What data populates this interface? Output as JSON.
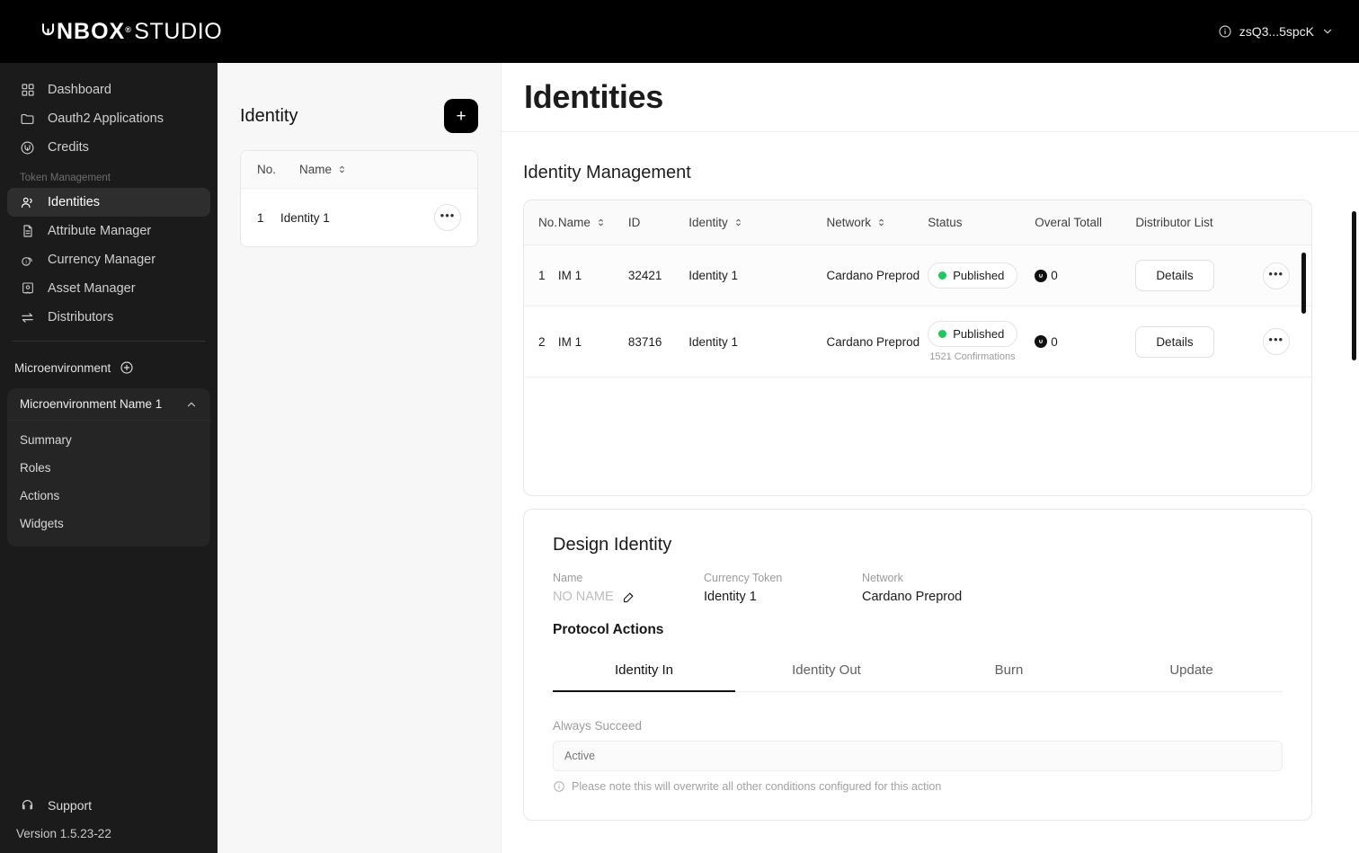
{
  "topbar": {
    "logo_mark": "U",
    "logo_bold": "NBOX",
    "logo_reg": "®",
    "logo_light": "STUDIO",
    "account_label": "zsQ3...5spcK",
    "info_icon": "info-circle-icon",
    "chevron_icon": "chevron-down-icon"
  },
  "sidebar": {
    "primary": [
      {
        "label": "Dashboard",
        "icon": "grid-icon"
      },
      {
        "label": "Oauth2 Applications",
        "icon": "folder-icon"
      },
      {
        "label": "Credits",
        "icon": "credits-circle-icon"
      }
    ],
    "section_label": "Token Management",
    "token_items": [
      {
        "label": "Identities",
        "icon": "users-icon",
        "active": true
      },
      {
        "label": "Attribute Manager",
        "icon": "document-icon",
        "active": false
      },
      {
        "label": "Currency Manager",
        "icon": "coins-icon",
        "active": false
      },
      {
        "label": "Asset Manager",
        "icon": "certificate-icon",
        "active": false
      },
      {
        "label": "Distributors",
        "icon": "transfer-arrows-icon",
        "active": false
      }
    ],
    "microenvironment_label": "Microenvironment",
    "microenvironment_add_icon": "plus-circle-icon",
    "micro_card": {
      "title": "Microenvironment Name 1",
      "collapse_icon": "chevron-up-icon",
      "items": [
        {
          "label": "Summary"
        },
        {
          "label": "Roles"
        },
        {
          "label": "Actions"
        },
        {
          "label": "Widgets"
        }
      ]
    },
    "support_label": "Support",
    "support_icon": "headset-icon",
    "version": "Version 1.5.23-22"
  },
  "identity_panel": {
    "title": "Identity",
    "add_button_label": "+",
    "columns": [
      "No.",
      "Name"
    ],
    "sort_icon": "sort-updown-icon",
    "rows": [
      {
        "no": "1",
        "name": "Identity 1",
        "menu_label": "•••"
      }
    ]
  },
  "page": {
    "title": "Identities"
  },
  "identity_management": {
    "title": "Identity Management",
    "columns": [
      {
        "label": "No.",
        "sortable": false
      },
      {
        "label": "Name",
        "sortable": true
      },
      {
        "label": "ID",
        "sortable": false
      },
      {
        "label": "Identity",
        "sortable": true
      },
      {
        "label": "Network",
        "sortable": true
      },
      {
        "label": "Status",
        "sortable": false
      },
      {
        "label": "Overal Totall",
        "sortable": false
      },
      {
        "label": "Distributor List",
        "sortable": false
      }
    ],
    "rows": [
      {
        "no": "1",
        "name": "IM 1",
        "id": "32421",
        "identity": "Identity 1",
        "network": "Cardano Preprod",
        "status": "Published",
        "confirmations": "",
        "total": "0",
        "details_label": "Details",
        "menu_label": "•••"
      },
      {
        "no": "2",
        "name": "IM 1",
        "id": "83716",
        "identity": "Identity 1",
        "network": "Cardano Preprod",
        "status": "Published",
        "confirmations": "1521 Confirmations",
        "total": "0",
        "details_label": "Details",
        "menu_label": "•••"
      }
    ],
    "status_dot_color": "#22c55e"
  },
  "design_identity": {
    "title": "Design Identity",
    "fields": [
      {
        "label": "Name",
        "value": "NO NAME",
        "muted": true,
        "edit_icon": "edit-pencil-icon"
      },
      {
        "label": "Currency Token",
        "value": "Identity 1",
        "muted": false
      },
      {
        "label": "Network",
        "value": "Cardano Preprod",
        "muted": false
      }
    ],
    "protocol_actions_title": "Protocol Actions",
    "tabs": [
      {
        "label": "Identity In",
        "active": true
      },
      {
        "label": "Identity Out",
        "active": false
      },
      {
        "label": "Burn",
        "active": false
      },
      {
        "label": "Update",
        "active": false
      }
    ],
    "form": {
      "field_label": "Always Succeed",
      "field_value": "",
      "field_placeholder": "Active",
      "note": "Please note this will overwrite all other conditions configured for this action",
      "note_icon": "info-circle-icon"
    }
  }
}
